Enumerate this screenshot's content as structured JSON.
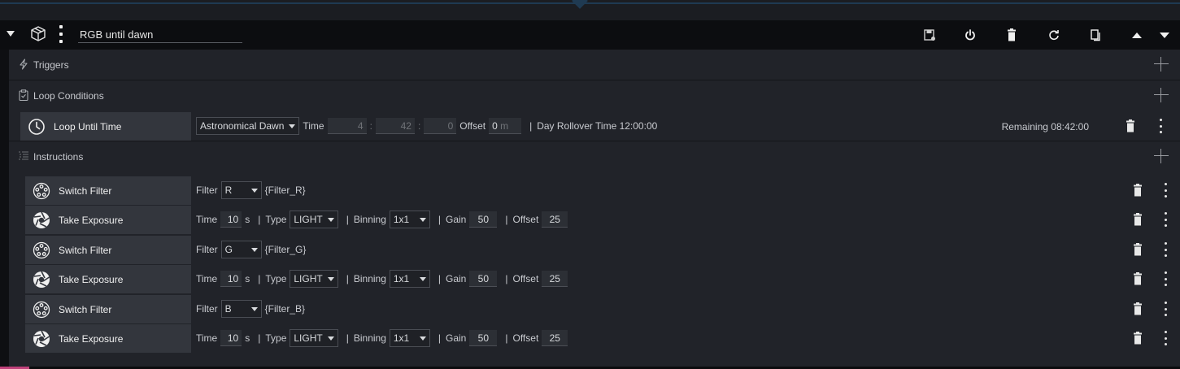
{
  "header": {
    "sequence_name": "RGB until dawn"
  },
  "sections": {
    "triggers": {
      "label": "Triggers"
    },
    "loop_conditions": {
      "label": "Loop Conditions"
    },
    "instructions": {
      "label": "Instructions"
    }
  },
  "loop_item": {
    "name": "Loop Until Time",
    "time_source": "Astronomical Dawn",
    "time_label": "Time",
    "hours": "4",
    "minutes": "42",
    "seconds": "0",
    "colon": ":",
    "offset_label": "Offset",
    "offset_value": "0",
    "offset_unit": "m",
    "separator": "|",
    "rollover_text": "Day Rollover Time 12:00:00",
    "remaining": "Remaining 08:42:00"
  },
  "instructions": [
    {
      "name": "Switch Filter",
      "filter_label": "Filter",
      "filter_value": "R",
      "filter_ref": "{Filter_R}"
    },
    {
      "name": "Take Exposure",
      "time_label": "Time",
      "time_value": "10",
      "time_unit": "s",
      "sep": "|",
      "type_label": "Type",
      "type_value": "LIGHT",
      "binning_label": "Binning",
      "binning_value": "1x1",
      "gain_label": "Gain",
      "gain_value": "50",
      "offset_label": "Offset",
      "offset_value": "25"
    },
    {
      "name": "Switch Filter",
      "filter_label": "Filter",
      "filter_value": "G",
      "filter_ref": "{Filter_G}"
    },
    {
      "name": "Take Exposure",
      "time_label": "Time",
      "time_value": "10",
      "time_unit": "s",
      "sep": "|",
      "type_label": "Type",
      "type_value": "LIGHT",
      "binning_label": "Binning",
      "binning_value": "1x1",
      "gain_label": "Gain",
      "gain_value": "50",
      "offset_label": "Offset",
      "offset_value": "25"
    },
    {
      "name": "Switch Filter",
      "filter_label": "Filter",
      "filter_value": "B",
      "filter_ref": "{Filter_B}"
    },
    {
      "name": "Take Exposure",
      "time_label": "Time",
      "time_value": "10",
      "time_unit": "s",
      "sep": "|",
      "type_label": "Type",
      "type_value": "LIGHT",
      "binning_label": "Binning",
      "binning_value": "1x1",
      "gain_label": "Gain",
      "gain_value": "50",
      "offset_label": "Offset",
      "offset_value": "25"
    }
  ],
  "icons": {
    "collapse": "caret-down-icon",
    "container": "cube-icon",
    "menu": "vertical-dots-icon",
    "save": "save-icon",
    "power": "power-icon",
    "delete": "trash-icon",
    "reset": "reset-icon",
    "duplicate": "copy-icon",
    "move_up": "triangle-up-icon",
    "move_down": "triangle-down-icon",
    "triggers": "lightning-icon",
    "loop_conditions": "clipboard-icon",
    "instructions": "list-icon",
    "clock": "clock-icon",
    "filter_wheel": "filter-wheel-icon",
    "shutter": "aperture-icon"
  },
  "colors": {
    "background": "#0e0f12",
    "panel": "#212329",
    "item_box": "#33363d",
    "text": "#d6d8dc",
    "accent_line": "#1f3a52"
  }
}
